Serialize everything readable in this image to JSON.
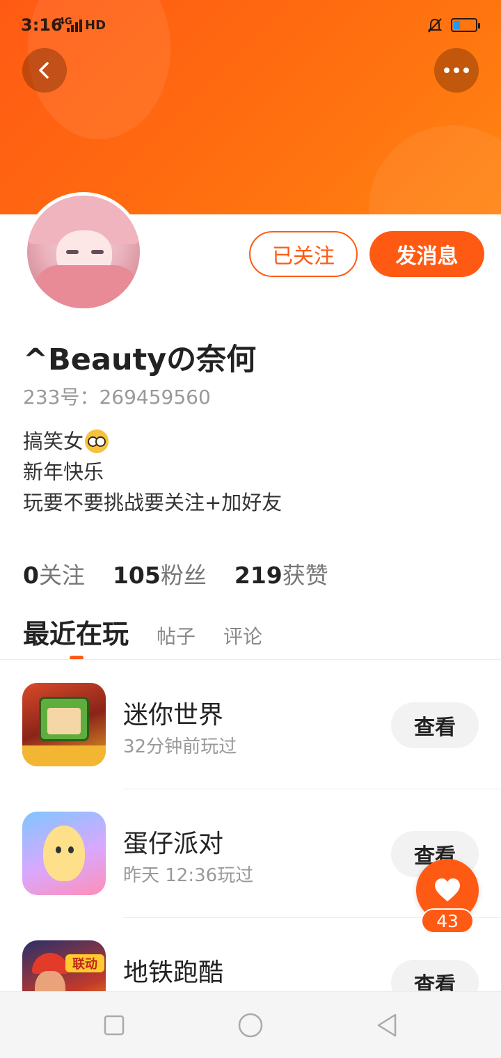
{
  "status_bar": {
    "time": "3:16",
    "network": "4G",
    "hd": "HD",
    "battery_level": 0.25,
    "battery_color": "#1d9bf0"
  },
  "header": {
    "accent": "#ff5a14",
    "back_icon": "chevron-left-icon",
    "more_icon": "more-horizontal-icon"
  },
  "profile": {
    "follow_label": "已关注",
    "message_label": "发消息",
    "name": "^Beautyの奈何",
    "id_text": "233号：269459560",
    "bio": [
      "搞笑女",
      "新年快乐",
      "玩要不要挑战要关注+加好友"
    ],
    "bio_emoji": "nerd-face-icon"
  },
  "stats": [
    {
      "num": "0",
      "label": "关注"
    },
    {
      "num": "105",
      "label": "粉丝"
    },
    {
      "num": "219",
      "label": "获赞"
    }
  ],
  "tabs": {
    "active": "最近在玩",
    "items": [
      "帖子",
      "评论"
    ]
  },
  "games": [
    {
      "name": "迷你世界",
      "time": "32分钟前玩过",
      "button": "查看"
    },
    {
      "name": "蛋仔派对",
      "time": "昨天 12:36玩过",
      "button": "查看"
    },
    {
      "name": "地铁跑酷",
      "time": "",
      "button": "查看",
      "icon_badge": "联动"
    }
  ],
  "fab": {
    "icon": "heart-icon",
    "count": "43"
  },
  "nav": {
    "icons": [
      "square-icon",
      "circle-icon",
      "triangle-back-icon"
    ]
  }
}
